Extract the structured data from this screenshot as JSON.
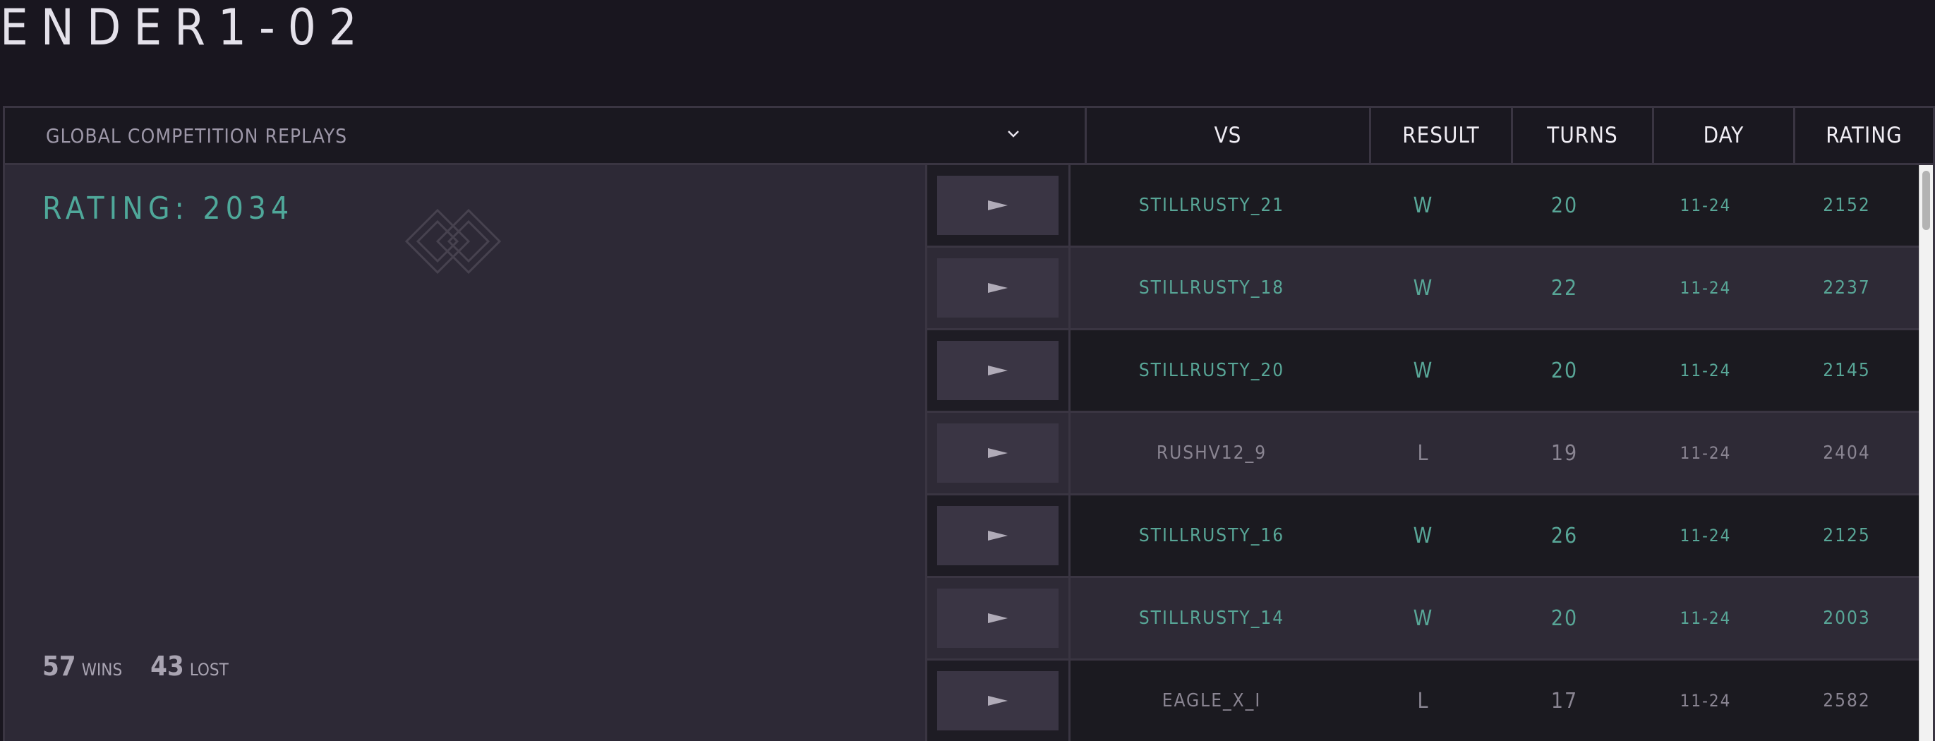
{
  "page": {
    "title": "ENDER1-02"
  },
  "header": {
    "dropdown_label": "GLOBAL COMPETITION REPLAYS",
    "columns": {
      "vs": "VS",
      "result": "RESULT",
      "turns": "TURNS",
      "day": "DAY",
      "rating": "RATING"
    }
  },
  "summary": {
    "rating_text": "RATING: 2034",
    "wins": "57",
    "wins_label": "WINS",
    "lost": "43",
    "lost_label": "LOST"
  },
  "colors": {
    "win": "#58a697",
    "loss": "#8a8592",
    "accent": "#4fa89a"
  },
  "rows": [
    {
      "vs": "STILLRUSTY_21",
      "result": "W",
      "turns": "20",
      "day": "11-24",
      "rating": "2152"
    },
    {
      "vs": "STILLRUSTY_18",
      "result": "W",
      "turns": "22",
      "day": "11-24",
      "rating": "2237"
    },
    {
      "vs": "STILLRUSTY_20",
      "result": "W",
      "turns": "20",
      "day": "11-24",
      "rating": "2145"
    },
    {
      "vs": "RUSHV12_9",
      "result": "L",
      "turns": "19",
      "day": "11-24",
      "rating": "2404"
    },
    {
      "vs": "STILLRUSTY_16",
      "result": "W",
      "turns": "26",
      "day": "11-24",
      "rating": "2125"
    },
    {
      "vs": "STILLRUSTY_14",
      "result": "W",
      "turns": "20",
      "day": "11-24",
      "rating": "2003"
    },
    {
      "vs": "EAGLE_X_I",
      "result": "L",
      "turns": "17",
      "day": "11-24",
      "rating": "2582"
    }
  ]
}
